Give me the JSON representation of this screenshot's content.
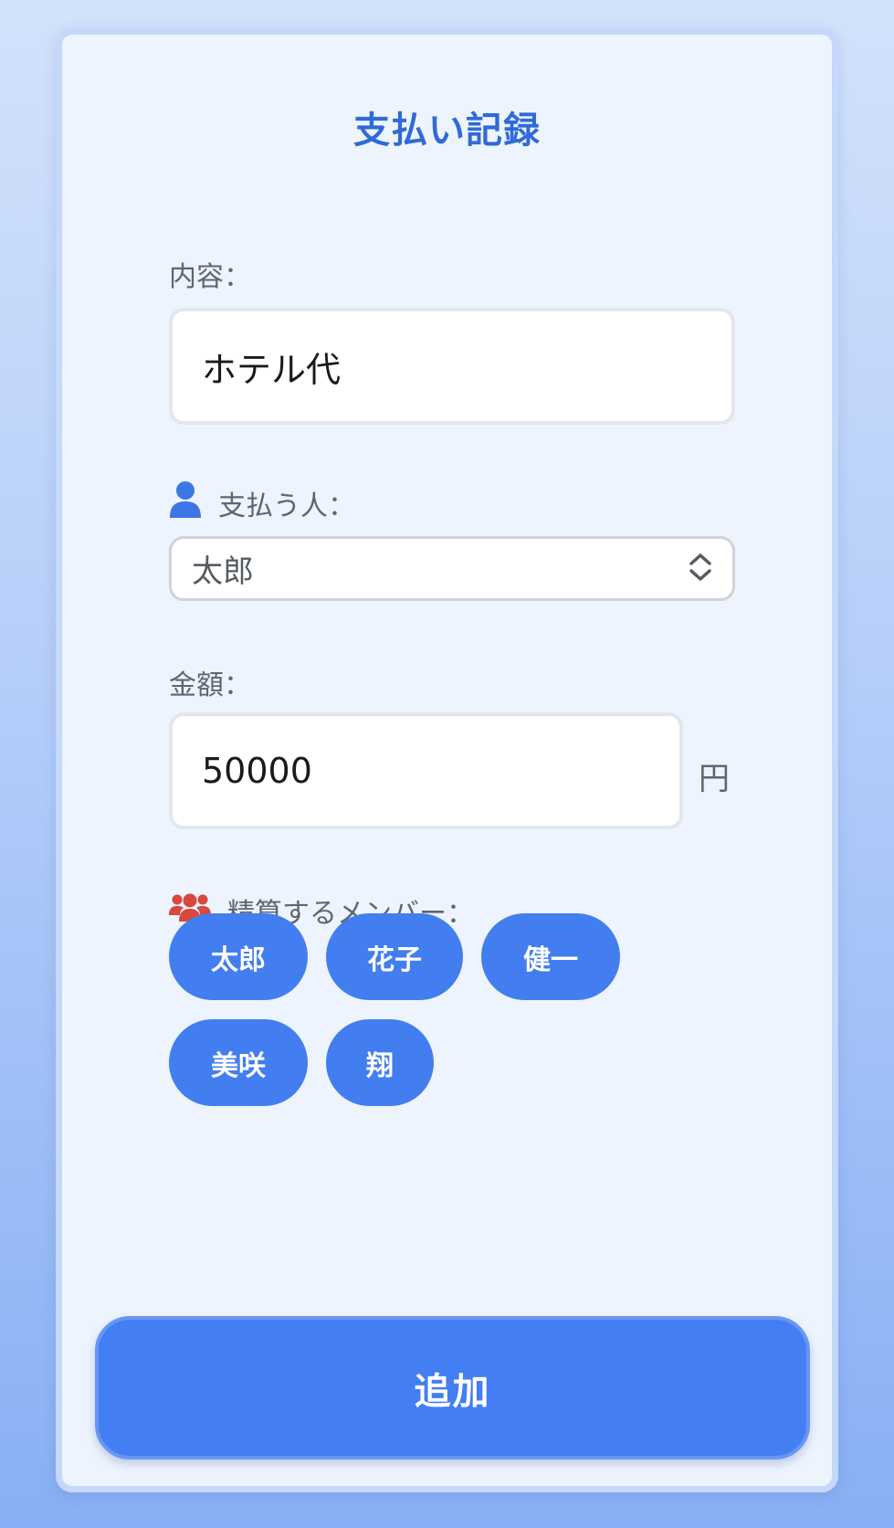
{
  "form": {
    "title": "支払い記録",
    "description": {
      "label": "内容：",
      "value": "ホテル代"
    },
    "payer": {
      "icon": "user-icon",
      "label": "支払う人：",
      "selected": "太郎"
    },
    "amount": {
      "label": "金額：",
      "value": "50000",
      "unit": "円"
    },
    "members": {
      "icon": "users-icon",
      "label": "精算するメンバー：",
      "items": [
        {
          "label": "太郎"
        },
        {
          "label": "花子"
        },
        {
          "label": "健一"
        },
        {
          "label": "美咲"
        },
        {
          "label": "翔"
        }
      ]
    },
    "submit_label": "追加"
  },
  "colors": {
    "accent": "#427ef0",
    "title": "#2f6ad9",
    "card_bg": "#eef4fe",
    "members_icon": "#d9473d",
    "payer_icon": "#3d76e6"
  }
}
